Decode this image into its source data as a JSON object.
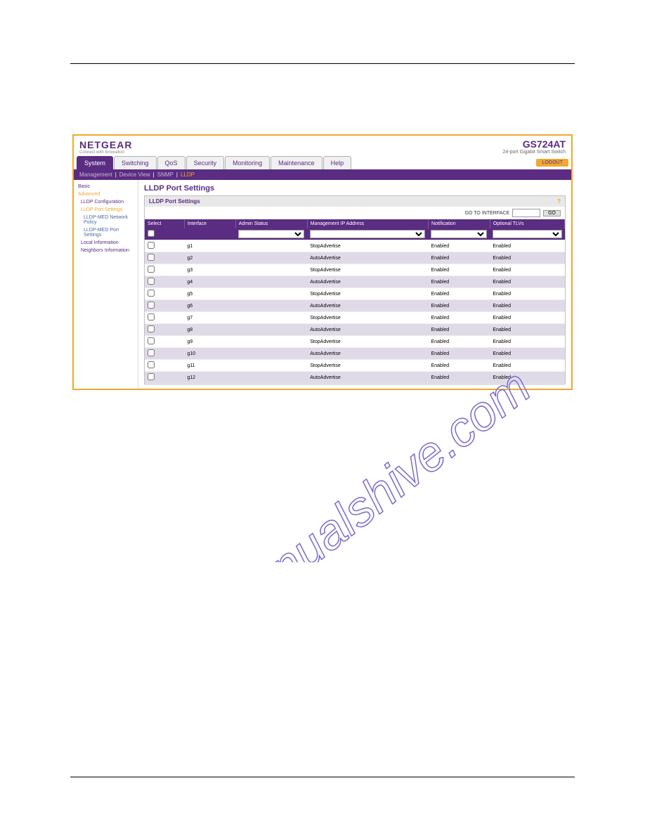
{
  "logo": {
    "main": "NETGEAR",
    "sub": "Connect with Innovation"
  },
  "model": {
    "main": "GS724AT",
    "sub": "24-port Gigabit Smart Switch"
  },
  "tabs": [
    "System",
    "Switching",
    "QoS",
    "Security",
    "Monitoring",
    "Maintenance",
    "Help"
  ],
  "logout": "LOGOUT",
  "subtabs": [
    "Management",
    "Device View",
    "SNMP",
    "LLDP"
  ],
  "sidebar": {
    "basic": "Basic",
    "advanced": "Advanced",
    "lldp_config": "LLDP Configuration",
    "lldp_port": "LLDP Port Settings",
    "lldp_med_policy": "LLDP-MED Network Policy",
    "lldp_med_port": "LLDP-MED Port Settings",
    "local_info": "Local Information",
    "neighbors": "Neighbors Information"
  },
  "panel": {
    "title": "LLDP Port Settings",
    "header": "LLDP Port Settings",
    "goto_label": "GO TO INTERFACE",
    "go": "GO"
  },
  "columns": [
    "Select",
    "Interface",
    "Admin Status",
    "Management IP Address",
    "Notification",
    "Optional TLVs"
  ],
  "rows": [
    {
      "iface": "g1",
      "mgmt": "StopAdvertise",
      "notif": "Enabled",
      "tlv": "Enabled"
    },
    {
      "iface": "g2",
      "mgmt": "AutoAdvertise",
      "notif": "Enabled",
      "tlv": "Enabled"
    },
    {
      "iface": "g3",
      "mgmt": "StopAdvertise",
      "notif": "Enabled",
      "tlv": "Enabled"
    },
    {
      "iface": "g4",
      "mgmt": "AutoAdvertise",
      "notif": "Enabled",
      "tlv": "Enabled"
    },
    {
      "iface": "g5",
      "mgmt": "StopAdvertise",
      "notif": "Enabled",
      "tlv": "Enabled"
    },
    {
      "iface": "g6",
      "mgmt": "AutoAdvertise",
      "notif": "Enabled",
      "tlv": "Enabled"
    },
    {
      "iface": "g7",
      "mgmt": "StopAdvertise",
      "notif": "Enabled",
      "tlv": "Enabled"
    },
    {
      "iface": "g8",
      "mgmt": "AutoAdvertise",
      "notif": "Enabled",
      "tlv": "Enabled"
    },
    {
      "iface": "g9",
      "mgmt": "StopAdvertise",
      "notif": "Enabled",
      "tlv": "Enabled"
    },
    {
      "iface": "g10",
      "mgmt": "AutoAdvertise",
      "notif": "Enabled",
      "tlv": "Enabled"
    },
    {
      "iface": "g11",
      "mgmt": "StopAdvertise",
      "notif": "Enabled",
      "tlv": "Enabled"
    },
    {
      "iface": "g12",
      "mgmt": "AutoAdvertise",
      "notif": "Enabled",
      "tlv": "Enabled"
    }
  ],
  "watermark": "manualshive.com"
}
